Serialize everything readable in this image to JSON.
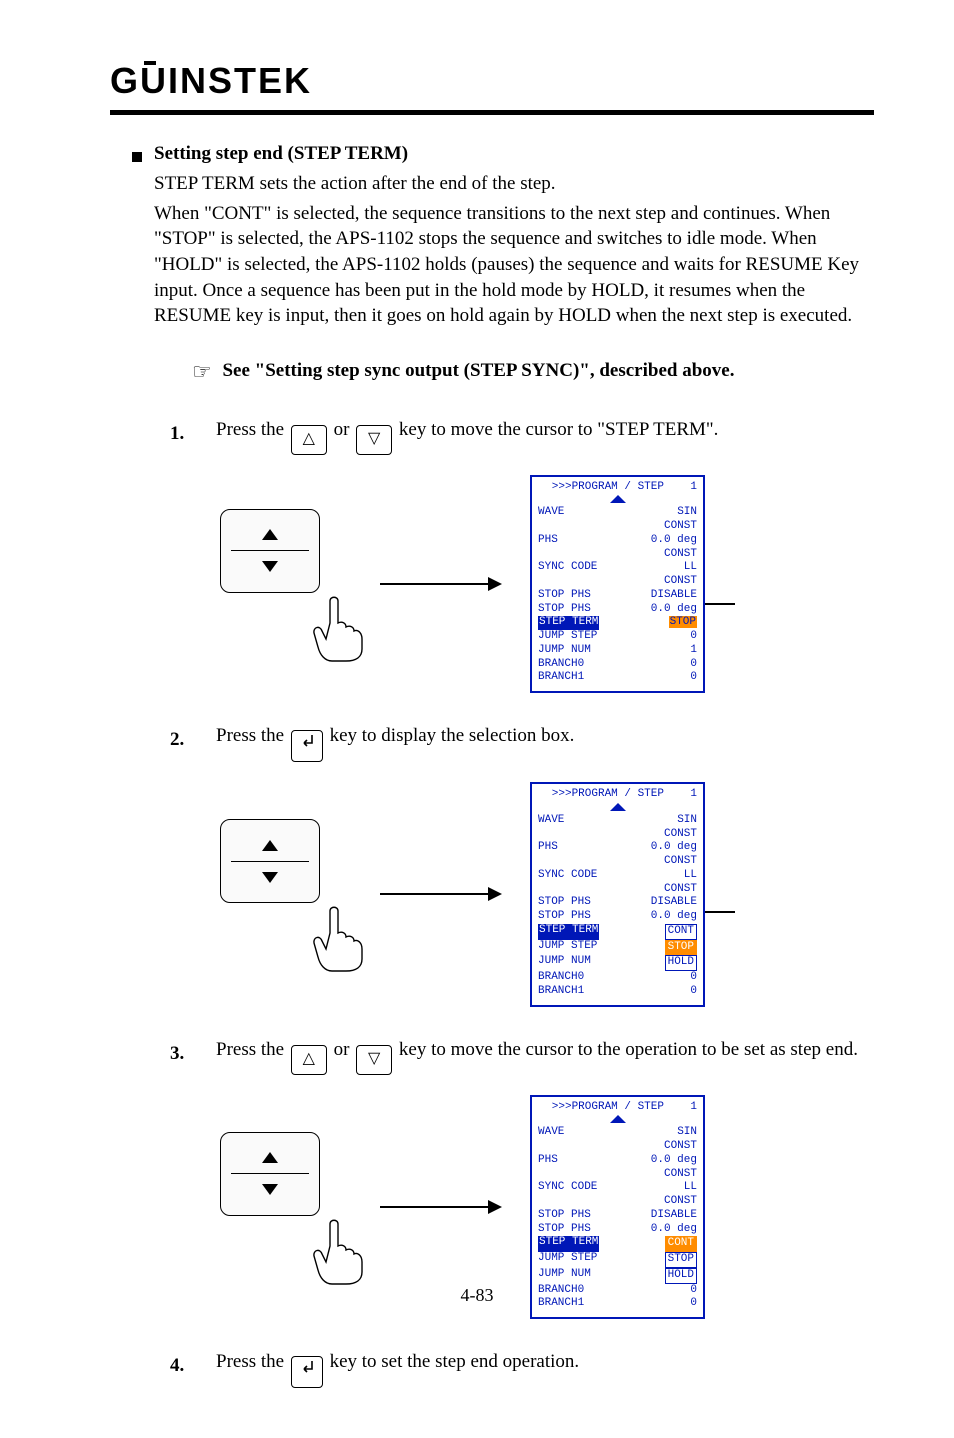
{
  "logo": "GWINSTEK",
  "section": {
    "title": "Setting step end (STEP TERM)",
    "intro": "STEP TERM sets the action after the end of the step.",
    "desc_prefix": "When ",
    "desc_cont": "\"CONT\" is selected, the sequence transitions to the next step and continues. When \"STOP\" is selected, the APS-1102 stops the sequence and switches to idle mode. When \"HOLD\" is selected, the APS-1102 holds (pauses) the sequence and waits for RESUME Key input. Once a sequence has been put in the hold mode by HOLD, it resumes when the RESUME key is input, then it goes on hold again by HOLD when the next step is executed.",
    "see_ref": "See \"Setting step sync output (STEP SYNC)\", described above."
  },
  "steps": {
    "s1": {
      "num": "1.",
      "a": "Press the ",
      "b": " or ",
      "c": " key to move the cursor to \"STEP TERM\"."
    },
    "s2": {
      "num": "2.",
      "a": "Press the ",
      "b": " key to display the selection box."
    },
    "s3": {
      "num": "3.",
      "a": "Press the ",
      "b": " or ",
      "c": " key to move the cursor to the operation to be set as step end."
    },
    "s4": {
      "num": "4.",
      "a": "Press the ",
      "b": " key to set the step end operation."
    }
  },
  "lcd": {
    "title_prefix": ">>>PROGRAM / STEP",
    "step_no": "1",
    "rows": {
      "wave_l": "WAVE",
      "wave_r": "SIN",
      "wave_c": "CONST",
      "phs_l": "PHS",
      "phs_r": "0.0 deg",
      "phs_c": "CONST",
      "sync_l": "SYNC CODE",
      "sync_r": "LL",
      "sync_c": "CONST",
      "stop_phs_l": "STOP PHS",
      "stop_phs_r": "DISABLE",
      "stop_phs2_l": "STOP PHS",
      "stop_phs2_r": "0.0 deg",
      "step_term_l": "STEP TERM",
      "step_term_r_stop": "STOP",
      "jump_step_l": "JUMP STEP",
      "jump_step_r": "0",
      "jump_num_l": "JUMP NUM",
      "jump_num_r": "1",
      "branch0_l": "BRANCH0",
      "branch0_r": "0",
      "branch1_l": "BRANCH1",
      "branch1_r": "0",
      "opt_cont": "CONT",
      "opt_stop": "STOP",
      "opt_hold": "HOLD"
    }
  },
  "page_number": "4-83"
}
